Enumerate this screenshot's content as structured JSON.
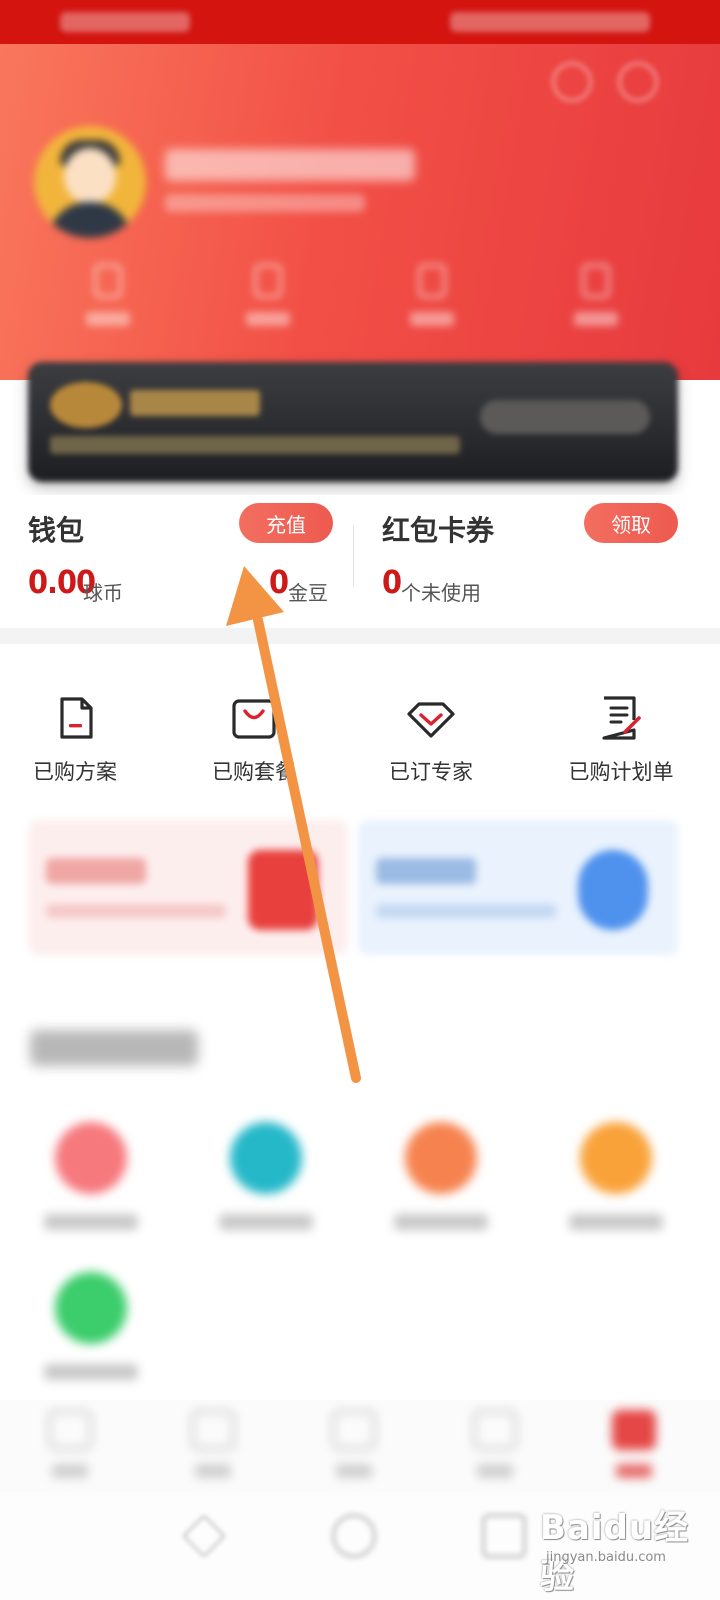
{
  "wallet": {
    "title": "钱包",
    "recharge_label": "充值",
    "coin_value": "0.00",
    "coin_unit": "球币",
    "bean_value": "0",
    "bean_unit": "金豆"
  },
  "coupons": {
    "title": "红包卡券",
    "claim_label": "领取",
    "unused_value": "0",
    "unused_unit": "个未使用"
  },
  "quick_actions": [
    {
      "label": "已购方案",
      "icon": "document-icon"
    },
    {
      "label": "已购套餐",
      "icon": "shopping-bag-icon"
    },
    {
      "label": "已订专家",
      "icon": "diamond-icon"
    },
    {
      "label": "已购计划单",
      "icon": "plan-list-icon"
    }
  ],
  "watermark": {
    "brand": "Baidu经验",
    "url": "jingyan.baidu.com"
  },
  "colors": {
    "brand_red": "#e8413e",
    "price_red": "#cc1a1a",
    "arrow_orange": "#f39444"
  }
}
